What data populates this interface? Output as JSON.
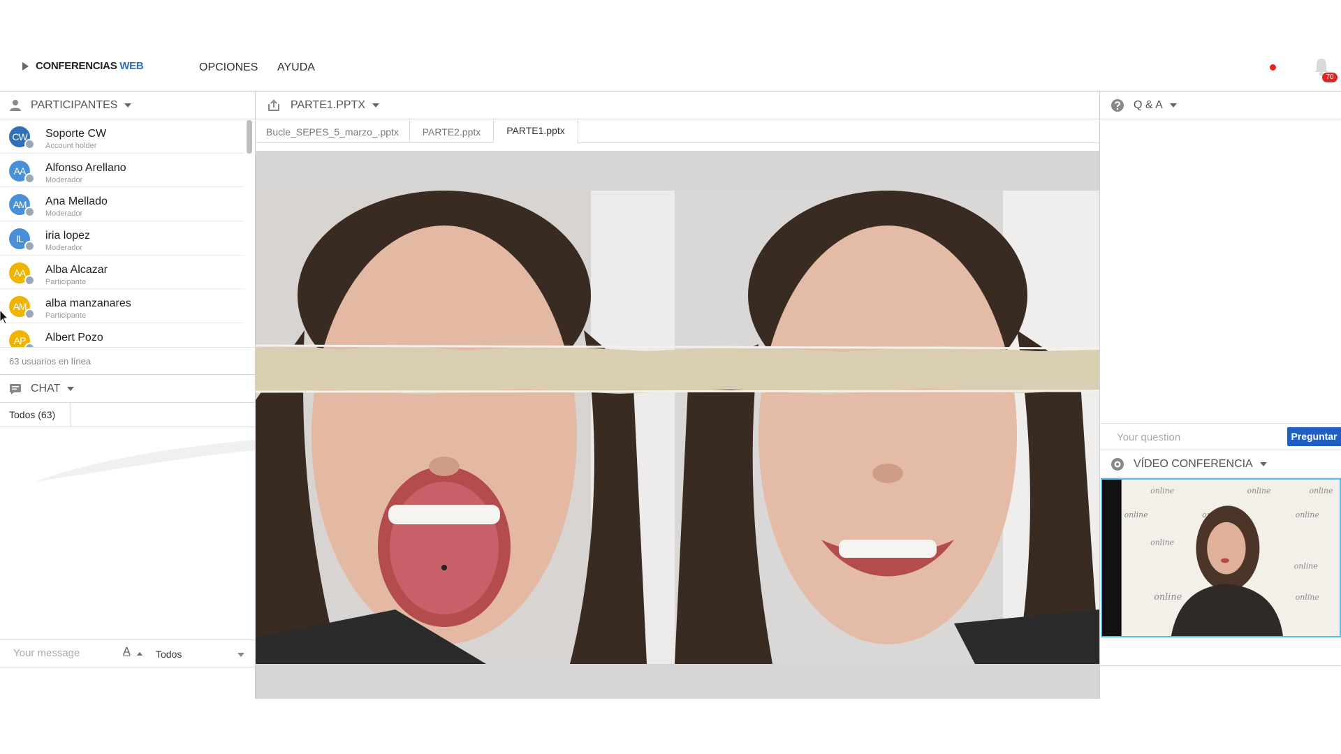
{
  "header": {
    "brand_main": "CONFERENCIAS",
    "brand_accent": "WEB",
    "menu": [
      "OPCIONES",
      "AYUDA"
    ],
    "notification_count": "70",
    "recording_color": "#e02424"
  },
  "participants": {
    "title": "PARTICIPANTES",
    "online_text": "63 usuarios en línea",
    "items": [
      {
        "initials": "CW",
        "name": "Soporte CW",
        "role": "Account holder",
        "color": "#2f6fb5"
      },
      {
        "initials": "AA",
        "name": "Alfonso Arellano",
        "role": "Moderador",
        "color": "#4a90d9"
      },
      {
        "initials": "AM",
        "name": "Ana Mellado",
        "role": "Moderador",
        "color": "#4a90d9"
      },
      {
        "initials": "IL",
        "name": "iria lopez",
        "role": "Moderador",
        "color": "#4a90d9"
      },
      {
        "initials": "AA",
        "name": "Alba Alcazar",
        "role": "Participante",
        "color": "#f0b400"
      },
      {
        "initials": "AM",
        "name": "alba manzanares",
        "role": "Participante",
        "color": "#f0b400"
      },
      {
        "initials": "AP",
        "name": "Albert Pozo",
        "role": "",
        "color": "#f0b400"
      }
    ]
  },
  "chat": {
    "title": "CHAT",
    "tab_label": "Todos (63)",
    "input_placeholder": "Your message",
    "font_button": "A",
    "recipient": "Todos"
  },
  "presentation": {
    "title": "PARTE1.PPTX",
    "tabs": [
      {
        "label": "Bucle_SEPES_5_marzo_.pptx",
        "active": false
      },
      {
        "label": "PARTE2.pptx",
        "active": false
      },
      {
        "label": "PARTE1.pptx",
        "active": true
      }
    ]
  },
  "qa": {
    "title": "Q & A",
    "input_placeholder": "Your question",
    "ask_button": "Preguntar"
  },
  "video": {
    "title": "VÍDEO CONFERENCIA",
    "backdrop_text": "online"
  },
  "icons": {
    "participants": "person-icon",
    "presentation": "upload-icon",
    "qa": "question-icon",
    "chat": "chat-icon",
    "video": "camera-icon",
    "notifications": "bell-icon"
  }
}
